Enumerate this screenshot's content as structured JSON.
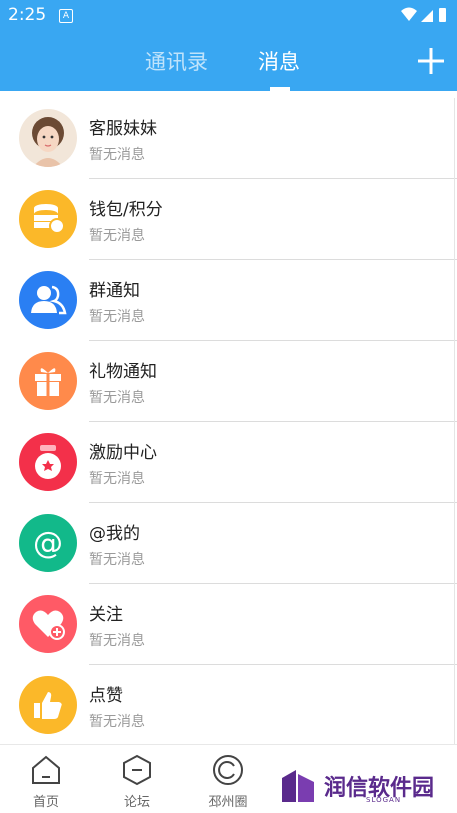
{
  "status_bar": {
    "time": "2:25",
    "badge": "A"
  },
  "tabs": [
    {
      "label": "通讯录",
      "active": false
    },
    {
      "label": "消息",
      "active": true
    }
  ],
  "add_icon": "plus-icon",
  "messages": [
    {
      "title": "客服妹妹",
      "subtitle": "暂无消息",
      "icon": "customer-service-avatar",
      "color": "#f0c9b8"
    },
    {
      "title": "钱包/积分",
      "subtitle": "暂无消息",
      "icon": "coins-icon",
      "color": "#fbb829"
    },
    {
      "title": "群通知",
      "subtitle": "暂无消息",
      "icon": "group-icon",
      "color": "#2a7ff3"
    },
    {
      "title": "礼物通知",
      "subtitle": "暂无消息",
      "icon": "gift-icon",
      "color": "#ff8a4b"
    },
    {
      "title": "激励中心",
      "subtitle": "暂无消息",
      "icon": "medal-icon",
      "color": "#f3304a"
    },
    {
      "title": "@我的",
      "subtitle": "暂无消息",
      "icon": "at-icon",
      "color": "#12b98a"
    },
    {
      "title": "关注",
      "subtitle": "暂无消息",
      "icon": "heart-plus-icon",
      "color": "#ff5a66"
    },
    {
      "title": "点赞",
      "subtitle": "暂无消息",
      "icon": "thumbs-up-icon",
      "color": "#fbb829"
    }
  ],
  "bottom_nav": [
    {
      "label": "首页",
      "icon": "home-icon"
    },
    {
      "label": "论坛",
      "icon": "forum-icon"
    },
    {
      "label": "邳州圈",
      "icon": "circle-icon"
    }
  ],
  "watermark": {
    "text": "润信软件园",
    "slogan": "SLOGAN"
  }
}
